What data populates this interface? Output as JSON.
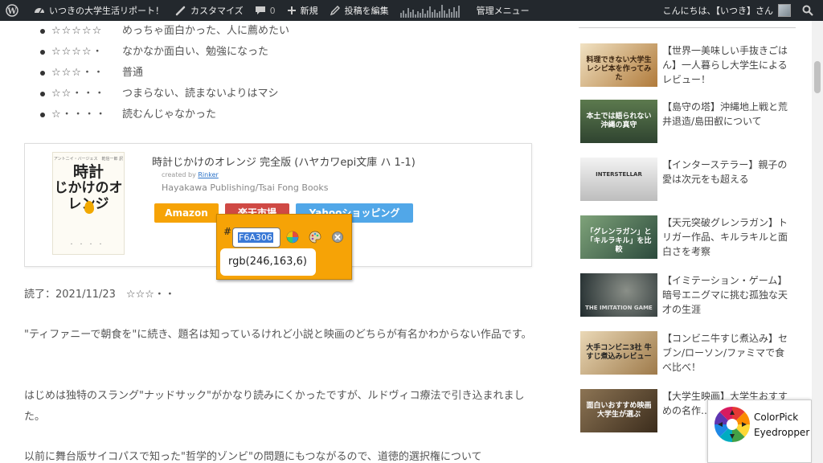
{
  "adminbar": {
    "site_name": "いつきの大学生活リポート！",
    "customize": "カスタマイズ",
    "comments_count": "0",
    "new": "新規",
    "edit_post": "投稿を編集",
    "admin_menu": "管理メニュー",
    "greeting": "こんにちは、【いつき】さん"
  },
  "ratings": [
    {
      "stars": "☆☆☆☆☆",
      "text": "めっちゃ面白かった、人に薦めたい"
    },
    {
      "stars": "☆☆☆☆・",
      "text": "なかなか面白い、勉強になった"
    },
    {
      "stars": "☆☆☆・・",
      "text": "普通"
    },
    {
      "stars": "☆☆・・・",
      "text": "つまらない、読まないよりはマシ"
    },
    {
      "stars": "☆・・・・",
      "text": "読むんじゃなかった"
    }
  ],
  "book": {
    "cover_author": "アントニイ・バージェス　乾信一郎 訳",
    "cover_title_1": "時計",
    "cover_title_2": "じかけのオレンジ",
    "title": "時計じかけのオレンジ 完全版 (ハヤカワepi文庫 ハ 1-1)",
    "created_by": "created by",
    "created_by_link": "Rinker",
    "publisher": "Hayakawa Publishing/Tsai Fong Books",
    "buttons": {
      "amazon": "Amazon",
      "rakuten": "楽天市場",
      "yahoo": "Yahooショッピング"
    }
  },
  "article": {
    "read_date": "読了：2021/11/23　☆☆☆・・",
    "p1": "\"ティファニーで朝食を\"に続き、題名は知っているけれど小説と映画のどちらが有名かわからない作品です。",
    "p2": "はじめは独特のスラング\"ナッドサック\"がかなり読みにくかったですが、ルドヴィコ療法で引き込まれました。",
    "p3": "以前に舞台版サイコパスで知った\"哲学的ゾンビ\"の問題にもつながるので、道徳的選択権について"
  },
  "sidebar": {
    "items": [
      {
        "thumb": "料理できない大学生 レシピ本を作ってみた",
        "title": "【世界一美味しい手抜きごはん】一人暮らし大学生によるレビュー！",
        "color": "#8a5a2b"
      },
      {
        "thumb": "本土では語られない 沖縄の真守",
        "title": "【島守の塔】沖縄地上戦と荒井退造/島田叡について",
        "color": "#3d5a3a"
      },
      {
        "thumb": "INTERSTELLAR",
        "title": "【インターステラー】親子の愛は次元をも超える",
        "color": "#d9d9d9"
      },
      {
        "thumb": "「グレンラガン」と「キルラキル」を比較",
        "title": "【天元突破グレンラガン】トリガー作品、キルラキルと面白さを考察",
        "color": "#4a6a4a"
      },
      {
        "thumb": "THE IMITATION GAME",
        "title": "【イミテーション・ゲーム】暗号エニグマに挑む孤独な天才の生涯",
        "color": "#2f3a3e"
      },
      {
        "thumb": "大手コンビニ3社 牛すじ煮込みレビュー",
        "title": "【コンビニ牛すじ煮込み】セブン/ローソン/ファミマで食べ比べ！",
        "color": "#c7b08c"
      },
      {
        "thumb": "面白いおすすめ映画 大学生が選ぶ",
        "title": "【大学生映画】大学生おすすめの名作…すじ/感想…",
        "color": "#5a4630"
      }
    ]
  },
  "picker": {
    "hash": "#",
    "hex": "F6A306",
    "rgb": "rgb(246,163,6)",
    "color": "#f6a306"
  },
  "extension": {
    "label": "ColorPick Eyedropper"
  }
}
